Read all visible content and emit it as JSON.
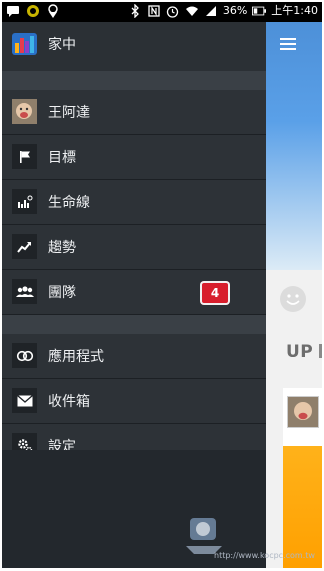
{
  "status_bar": {
    "battery_percent": "36%",
    "time": "上午1:40",
    "icons": [
      "chat-icon",
      "line-icon",
      "location-icon",
      "bluetooth-icon",
      "nfc-icon",
      "alarm-icon",
      "wifi-icon",
      "signal-icon",
      "battery-icon"
    ]
  },
  "drawer": {
    "header_label": "家中",
    "section1": [
      {
        "label": "王阿達",
        "icon": "avatar"
      },
      {
        "label": "目標",
        "icon": "flag-icon"
      },
      {
        "label": "生命線",
        "icon": "lifeline-icon"
      },
      {
        "label": "趨勢",
        "icon": "trend-icon"
      },
      {
        "label": "團隊",
        "icon": "team-icon",
        "badge": "4"
      }
    ],
    "section2": [
      {
        "label": "應用程式",
        "icon": "apps-icon"
      },
      {
        "label": "收件箱",
        "icon": "envelope-icon"
      },
      {
        "label": "設定",
        "icon": "gear-icon"
      }
    ]
  },
  "peek": {
    "up_text": "UP"
  },
  "watermark": {
    "url": "http://www.kocpc.com.tw"
  },
  "colors": {
    "drawer_bg": "#2d3237",
    "badge": "#d81e2c",
    "accent_blue": "#4d90d8",
    "orange": "#ffa000"
  }
}
